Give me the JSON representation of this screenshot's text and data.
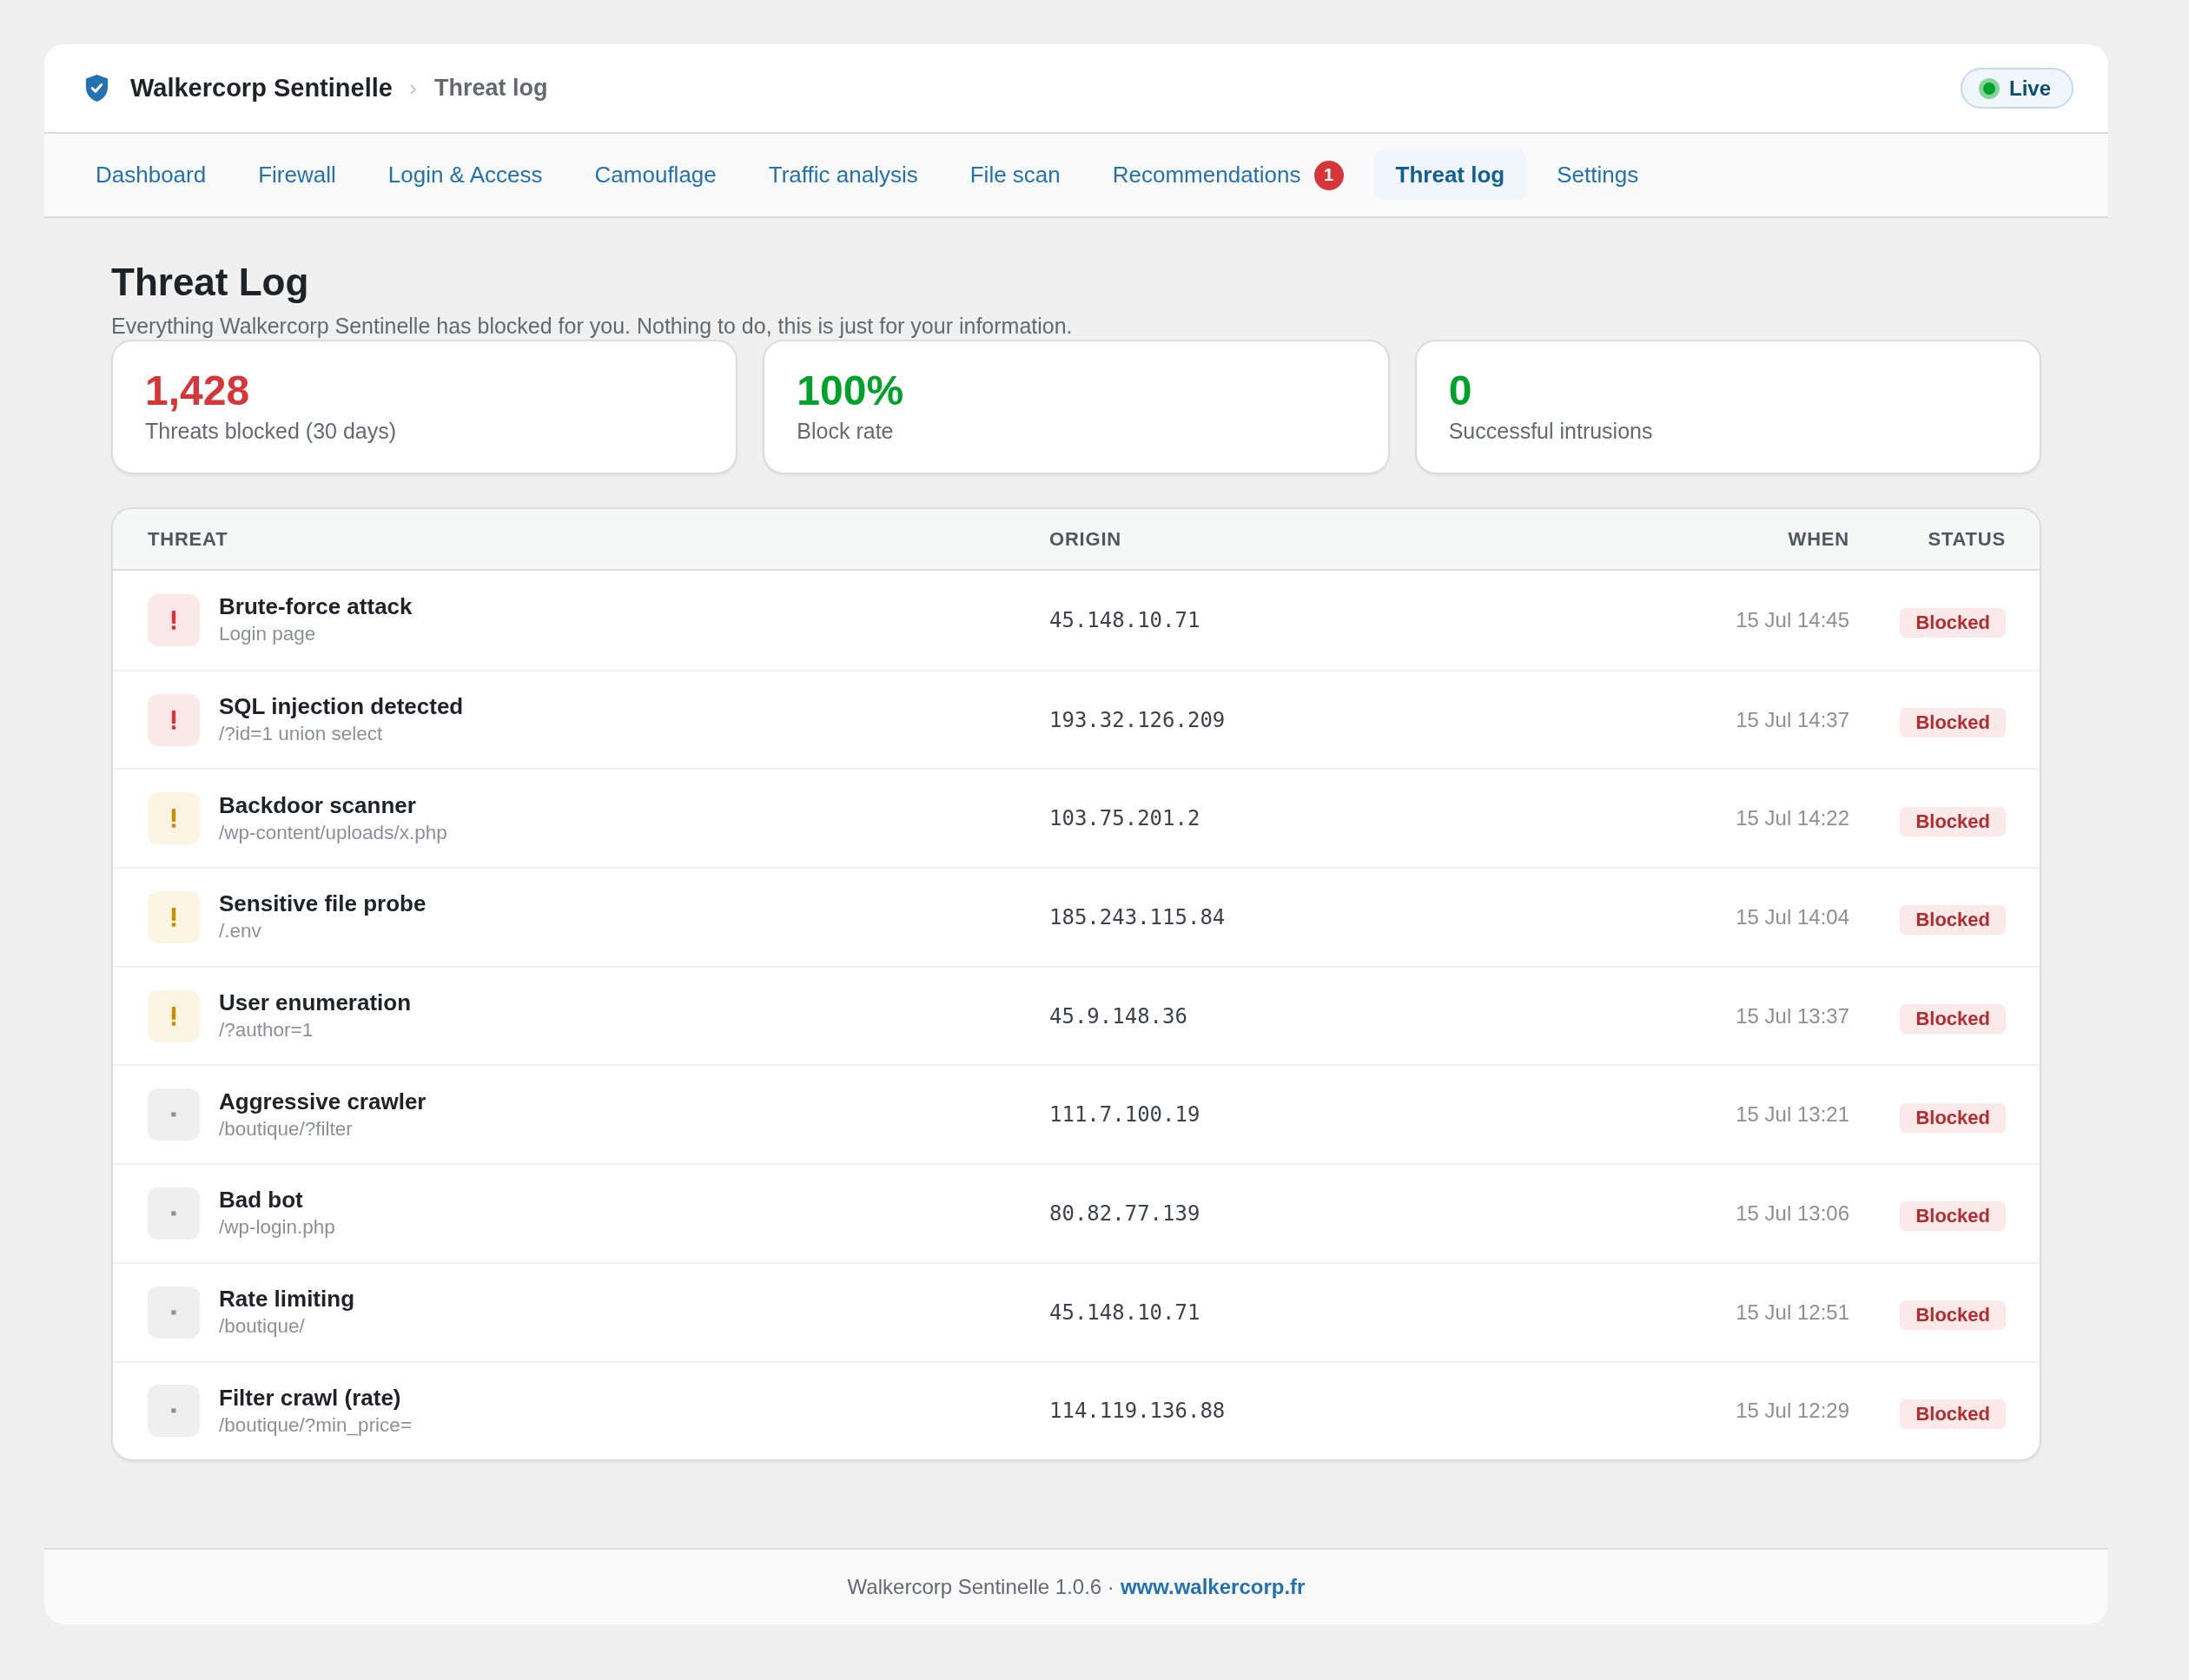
{
  "header": {
    "app_name": "Walkercorp Sentinelle",
    "breadcrumb": "Threat log",
    "status": {
      "label": "Live",
      "active": true
    }
  },
  "tabs": [
    {
      "label": "Dashboard",
      "selected": false
    },
    {
      "label": "Firewall",
      "selected": false
    },
    {
      "label": "Login & Access",
      "selected": false
    },
    {
      "label": "Camouflage",
      "selected": false
    },
    {
      "label": "Traffic analysis",
      "selected": false
    },
    {
      "label": "File scan",
      "selected": false
    },
    {
      "label": "Recommendations",
      "selected": false,
      "badge": "1"
    },
    {
      "label": "Threat log",
      "selected": true
    },
    {
      "label": "Settings",
      "selected": false
    }
  ],
  "page": {
    "title": "Threat Log",
    "subtitle": "Everything Walkercorp Sentinelle has blocked for you. Nothing to do, this is just for your information."
  },
  "stats": [
    {
      "value": "1,428",
      "label": "Threats blocked (30 days)",
      "color": "#d63638"
    },
    {
      "value": "100%",
      "label": "Block rate",
      "color": "#00a32a"
    },
    {
      "value": "0",
      "label": "Successful intrusions",
      "color": "#00a32a"
    }
  ],
  "threats": {
    "columns": [
      "THREAT",
      "ORIGIN",
      "WHEN",
      "STATUS"
    ],
    "rows": [
      {
        "kind": "danger",
        "name": "Brute-force attack",
        "target": "Login page",
        "origin": "45.148.10.71",
        "when": "15 Jul 14:45",
        "status": "Blocked"
      },
      {
        "kind": "danger",
        "name": "SQL injection detected",
        "target": "/?id=1 union select",
        "origin": "193.32.126.209",
        "when": "15 Jul 14:37",
        "status": "Blocked"
      },
      {
        "kind": "warning",
        "name": "Backdoor scanner",
        "target": "/wp-content/uploads/x.php",
        "origin": "103.75.201.2",
        "when": "15 Jul 14:22",
        "status": "Blocked"
      },
      {
        "kind": "warning",
        "name": "Sensitive file probe",
        "target": "/.env",
        "origin": "185.243.115.84",
        "when": "15 Jul 14:04",
        "status": "Blocked"
      },
      {
        "kind": "warning",
        "name": "User enumeration",
        "target": "/?author=1",
        "origin": "45.9.148.36",
        "when": "15 Jul 13:37",
        "status": "Blocked"
      },
      {
        "kind": "neutral",
        "name": "Aggressive crawler",
        "target": "/boutique/?filter",
        "origin": "111.7.100.19",
        "when": "15 Jul 13:21",
        "status": "Blocked"
      },
      {
        "kind": "neutral",
        "name": "Bad bot",
        "target": "/wp-login.php",
        "origin": "80.82.77.139",
        "when": "15 Jul 13:06",
        "status": "Blocked"
      },
      {
        "kind": "neutral",
        "name": "Rate limiting",
        "target": "/boutique/",
        "origin": "45.148.10.71",
        "when": "15 Jul 12:51",
        "status": "Blocked"
      },
      {
        "kind": "neutral",
        "name": "Filter crawl (rate)",
        "target": "/boutique/?min_price=",
        "origin": "114.119.136.88",
        "when": "15 Jul 12:29",
        "status": "Blocked"
      }
    ]
  },
  "footer": {
    "text": "Walkercorp Sentinelle 1.0.6 ·",
    "link": "www.walkercorp.fr"
  }
}
